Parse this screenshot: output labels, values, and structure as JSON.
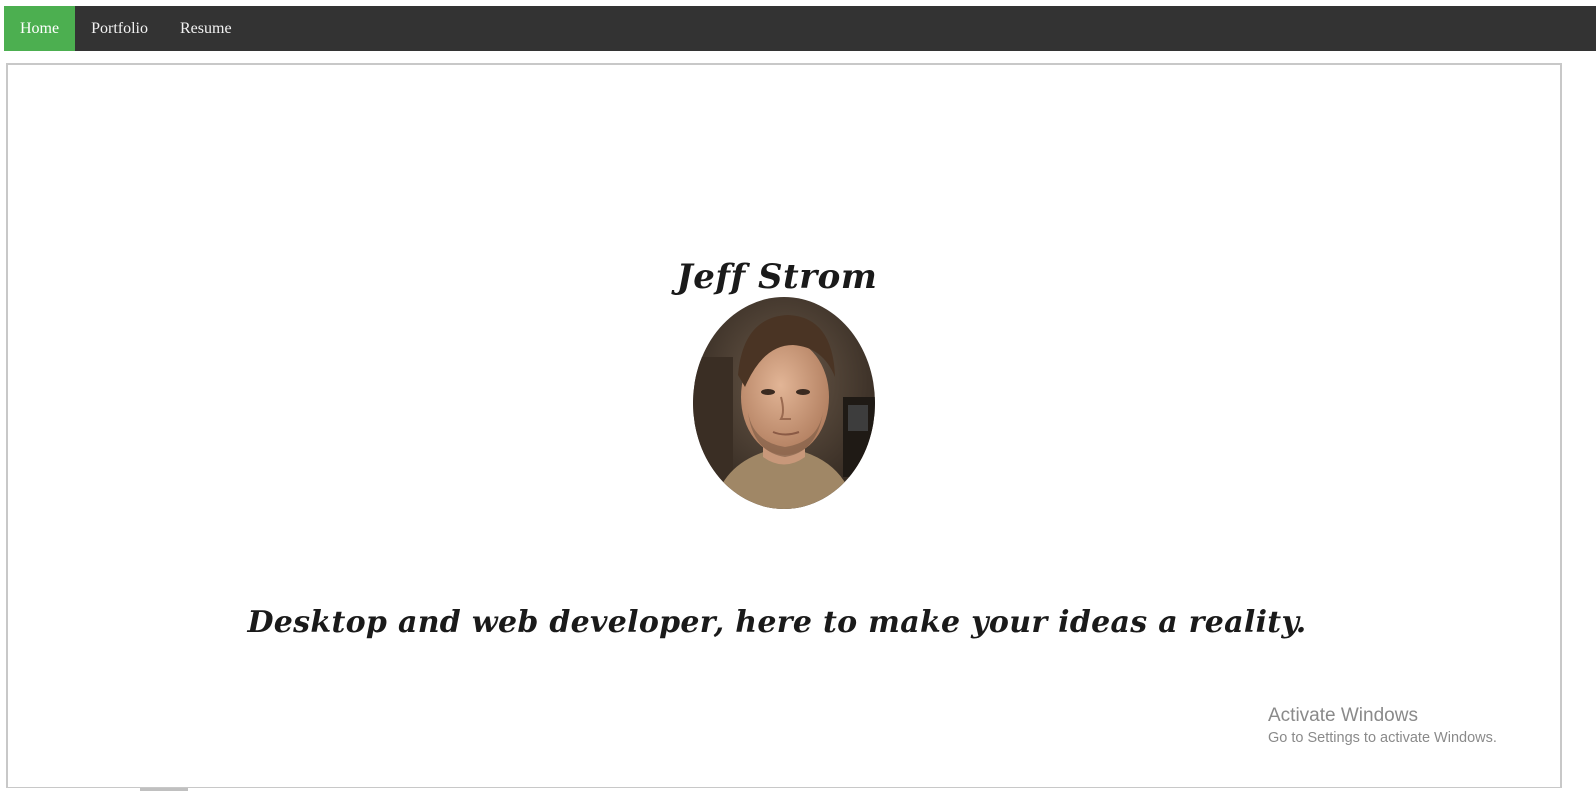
{
  "nav": {
    "items": [
      {
        "label": "Home",
        "active": true
      },
      {
        "label": "Portfolio",
        "active": false
      },
      {
        "label": "Resume",
        "active": false
      }
    ],
    "background": "#333333",
    "active_color": "#4caf50"
  },
  "main": {
    "name": "Jeff Strom",
    "avatar_icon": "profile-photo",
    "tagline": "Desktop and web developer, here to make your ideas a reality."
  },
  "watermark": {
    "title": "Activate Windows",
    "subtitle": "Go to Settings to activate Windows."
  }
}
